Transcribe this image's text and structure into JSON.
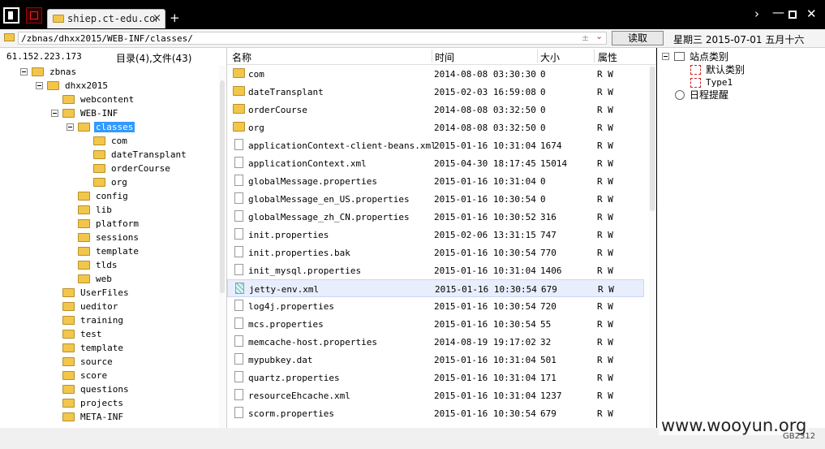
{
  "tab": {
    "title": "shiep.ct-edu.com.cn",
    "close": "×",
    "add": "+"
  },
  "window": {
    "expand": "›",
    "minimize": "—",
    "close": "✕"
  },
  "address": {
    "path": "/zbnas/dhxx2015/WEB-INF/classes/",
    "mid": "±",
    "drop": "⌄",
    "read_label": "读取",
    "date": "星期三  2015-07-01  五月十六"
  },
  "left": {
    "ip": "61.152.223.173",
    "counts": "目录(4),文件(43)",
    "tree": [
      {
        "label": "zbnas",
        "level": 1,
        "toggle": true
      },
      {
        "label": "dhxx2015",
        "level": 2,
        "toggle": true
      },
      {
        "label": "webcontent",
        "level": 3,
        "toggle": false
      },
      {
        "label": "WEB-INF",
        "level": 3,
        "toggle": true
      },
      {
        "label": "classes",
        "level": 4,
        "toggle": true,
        "selected": true
      },
      {
        "label": "com",
        "level": 5,
        "toggle": false
      },
      {
        "label": "dateTransplant",
        "level": 5,
        "toggle": false
      },
      {
        "label": "orderCourse",
        "level": 5,
        "toggle": false
      },
      {
        "label": "org",
        "level": 5,
        "toggle": false
      },
      {
        "label": "config",
        "level": 4,
        "toggle": false
      },
      {
        "label": "lib",
        "level": 4,
        "toggle": false
      },
      {
        "label": "platform",
        "level": 4,
        "toggle": false
      },
      {
        "label": "sessions",
        "level": 4,
        "toggle": false
      },
      {
        "label": "template",
        "level": 4,
        "toggle": false
      },
      {
        "label": "tlds",
        "level": 4,
        "toggle": false
      },
      {
        "label": "web",
        "level": 4,
        "toggle": false
      },
      {
        "label": "UserFiles",
        "level": 3,
        "toggle": false
      },
      {
        "label": "ueditor",
        "level": 3,
        "toggle": false
      },
      {
        "label": "training",
        "level": 3,
        "toggle": false
      },
      {
        "label": "test",
        "level": 3,
        "toggle": false
      },
      {
        "label": "template",
        "level": 3,
        "toggle": false
      },
      {
        "label": "source",
        "level": 3,
        "toggle": false
      },
      {
        "label": "score",
        "level": 3,
        "toggle": false
      },
      {
        "label": "questions",
        "level": 3,
        "toggle": false
      },
      {
        "label": "projects",
        "level": 3,
        "toggle": false
      },
      {
        "label": "META-INF",
        "level": 3,
        "toggle": false
      }
    ]
  },
  "columns": {
    "name": "名称",
    "time": "时间",
    "size": "大小",
    "attr": "属性"
  },
  "files": [
    {
      "name": "com",
      "time": "2014-08-08 03:30:30",
      "size": "0",
      "attr": "R W",
      "type": "folder"
    },
    {
      "name": "dateTransplant",
      "time": "2015-02-03 16:59:08",
      "size": "0",
      "attr": "R W",
      "type": "folder"
    },
    {
      "name": "orderCourse",
      "time": "2014-08-08 03:32:50",
      "size": "0",
      "attr": "R W",
      "type": "folder"
    },
    {
      "name": "org",
      "time": "2014-08-08 03:32:50",
      "size": "0",
      "attr": "R W",
      "type": "folder"
    },
    {
      "name": "applicationContext-client-beans.xml",
      "time": "2015-01-16 10:31:04",
      "size": "1674",
      "attr": "R W",
      "type": "file"
    },
    {
      "name": "applicationContext.xml",
      "time": "2015-04-30 18:17:45",
      "size": "15014",
      "attr": "R W",
      "type": "file"
    },
    {
      "name": "globalMessage.properties",
      "time": "2015-01-16 10:31:04",
      "size": "0",
      "attr": "R W",
      "type": "file"
    },
    {
      "name": "globalMessage_en_US.properties",
      "time": "2015-01-16 10:30:54",
      "size": "0",
      "attr": "R W",
      "type": "file"
    },
    {
      "name": "globalMessage_zh_CN.properties",
      "time": "2015-01-16 10:30:52",
      "size": "316",
      "attr": "R W",
      "type": "file"
    },
    {
      "name": "init.properties",
      "time": "2015-02-06 13:31:15",
      "size": "747",
      "attr": "R W",
      "type": "file"
    },
    {
      "name": "init.properties.bak",
      "time": "2015-01-16 10:30:54",
      "size": "770",
      "attr": "R W",
      "type": "file"
    },
    {
      "name": "init_mysql.properties",
      "time": "2015-01-16 10:31:04",
      "size": "1406",
      "attr": "R W",
      "type": "file"
    },
    {
      "name": "jetty-env.xml",
      "time": "2015-01-16 10:30:54",
      "size": "679",
      "attr": "R W",
      "type": "file",
      "selected": true
    },
    {
      "name": "log4j.properties",
      "time": "2015-01-16 10:30:54",
      "size": "720",
      "attr": "R W",
      "type": "file"
    },
    {
      "name": "mcs.properties",
      "time": "2015-01-16 10:30:54",
      "size": "55",
      "attr": "R W",
      "type": "file"
    },
    {
      "name": "memcache-host.properties",
      "time": "2014-08-19 19:17:02",
      "size": "32",
      "attr": "R W",
      "type": "file"
    },
    {
      "name": "mypubkey.dat",
      "time": "2015-01-16 10:31:04",
      "size": "501",
      "attr": "R W",
      "type": "file"
    },
    {
      "name": "quartz.properties",
      "time": "2015-01-16 10:31:04",
      "size": "171",
      "attr": "R W",
      "type": "file"
    },
    {
      "name": "resourceEhcache.xml",
      "time": "2015-01-16 10:31:04",
      "size": "1237",
      "attr": "R W",
      "type": "file"
    },
    {
      "name": "scorm.properties",
      "time": "2015-01-16 10:30:54",
      "size": "679",
      "attr": "R W",
      "type": "file"
    }
  ],
  "right": {
    "sites": "站点类别",
    "default": "默认类别",
    "type1": "Type1",
    "schedule": "日程提醒"
  },
  "watermark": "www.wooyun.org",
  "encoding": "GB2312"
}
